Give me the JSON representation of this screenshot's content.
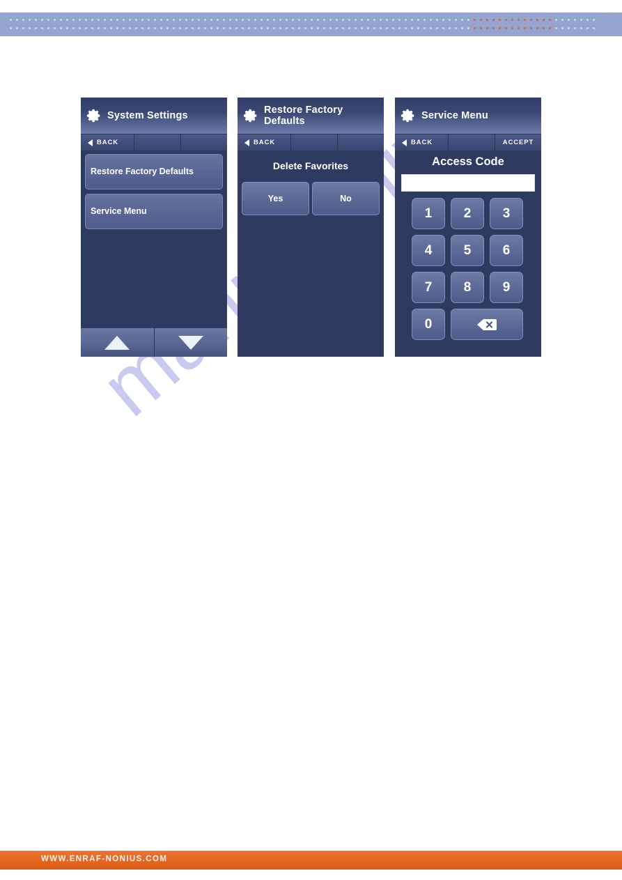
{
  "banner": {
    "dot_color": "#ccd6ea",
    "accent_dot_color": "#e2613a",
    "background": "#95a5cf",
    "dots_per_row": 94,
    "accent_start_index": 74,
    "accent_end_index": 86
  },
  "watermark": {
    "text": "manualshive.",
    "color": "#c9caee"
  },
  "footer": {
    "url": "WWW.ENRAF-NONIUS.COM",
    "background": "#e4661f",
    "text_color": "#fdf6ef"
  },
  "panels": [
    {
      "id": "system-settings",
      "title": "System Settings",
      "icon": "gear-icon",
      "toolbar": [
        {
          "label": "BACK",
          "icon": "back-arrow-icon"
        },
        {
          "label": ""
        },
        {
          "label": ""
        }
      ],
      "list_items": [
        {
          "label": "Restore Factory Defaults"
        },
        {
          "label": "Service Menu"
        }
      ],
      "nav": [
        {
          "icon": "arrow-up-icon"
        },
        {
          "icon": "arrow-down-icon"
        }
      ]
    },
    {
      "id": "restore-factory-defaults",
      "title": "Restore Factory Defaults",
      "icon": "gear-icon",
      "toolbar": [
        {
          "label": "BACK",
          "icon": "back-arrow-icon"
        },
        {
          "label": ""
        },
        {
          "label": ""
        }
      ],
      "prompt": "Delete Favorites",
      "buttons": [
        {
          "label": "Yes"
        },
        {
          "label": "No"
        }
      ]
    },
    {
      "id": "service-menu",
      "title": "Service Menu",
      "icon": "gear-icon",
      "toolbar": [
        {
          "label": "BACK",
          "icon": "back-arrow-icon"
        },
        {
          "label": ""
        },
        {
          "label": "ACCEPT"
        }
      ],
      "field_label": "Access Code",
      "field_value": "",
      "keypad": [
        {
          "label": "1"
        },
        {
          "label": "2"
        },
        {
          "label": "3"
        },
        {
          "label": "4"
        },
        {
          "label": "5"
        },
        {
          "label": "6"
        },
        {
          "label": "7"
        },
        {
          "label": "8"
        },
        {
          "label": "9"
        },
        {
          "label": "0"
        },
        {
          "label": "",
          "icon": "backspace-icon",
          "wide": true
        }
      ]
    }
  ],
  "colors": {
    "panel_background": "#2e3a60",
    "button_face": "#5d6a97",
    "header_gradient_top": "#323e66",
    "header_gradient_bottom": "#6f7cab",
    "text_on_dark": "#ffffff"
  }
}
